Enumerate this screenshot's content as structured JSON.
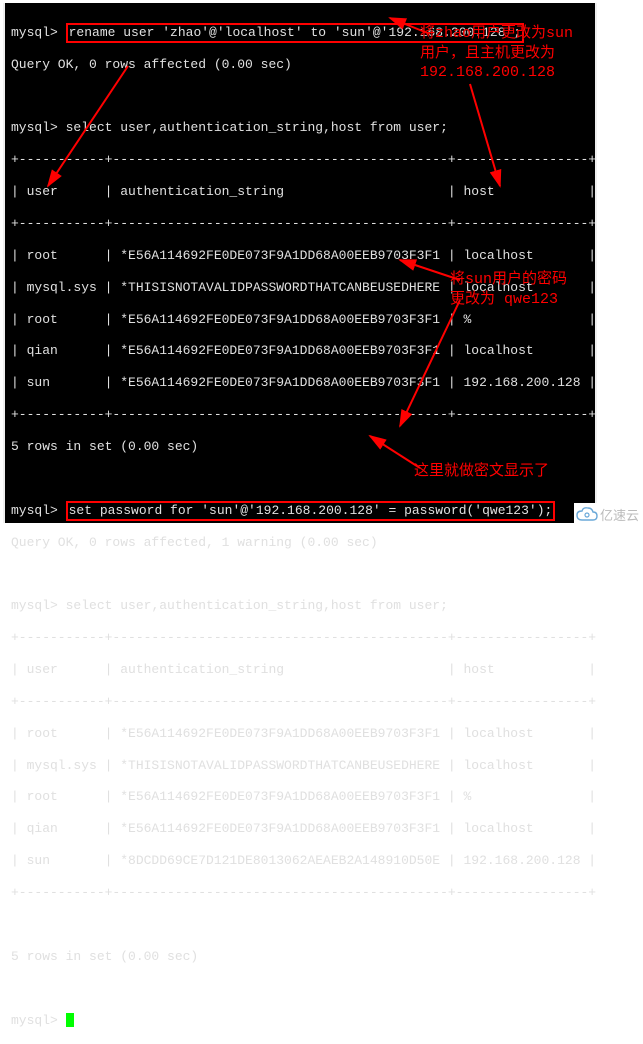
{
  "terminal": {
    "prompt": "mysql>",
    "cmd_rename": "rename user 'zhao'@'localhost' to 'sun'@'192.168.200.128';",
    "ok_rename": "Query OK, 0 rows affected (0.00 sec)",
    "cmd_select1": "select user,authentication_string,host from user;",
    "table_header": "| user      | authentication_string                     | host            |",
    "table_divider": "+-----------+-------------------------------------------+-----------------+",
    "rows1": [
      "| root      | *E56A114692FE0DE073F9A1DD68A00EEB9703F3F1 | localhost       |",
      "| mysql.sys | *THISISNOTAVALIDPASSWORDTHATCANBEUSEDHERE | localhost       |",
      "| root      | *E56A114692FE0DE073F9A1DD68A00EEB9703F3F1 | %               |",
      "| qian      | *E56A114692FE0DE073F9A1DD68A00EEB9703F3F1 | localhost       |",
      "| sun       | *E56A114692FE0DE073F9A1DD68A00EEB9703F3F1 | 192.168.200.128 |"
    ],
    "rows_in_set": "5 rows in set (0.00 sec)",
    "cmd_setpw": "set password for 'sun'@'192.168.200.128' = password('qwe123');",
    "ok_setpw": "Query OK, 0 rows affected, 1 warning (0.00 sec)",
    "cmd_select2": "select user,authentication_string,host from user;",
    "rows2": [
      "| root      | *E56A114692FE0DE073F9A1DD68A00EEB9703F3F1 | localhost       |",
      "| mysql.sys | *THISISNOTAVALIDPASSWORDTHATCANBEUSEDHERE | localhost       |",
      "| root      | *E56A114692FE0DE073F9A1DD68A00EEB9703F3F1 | %               |",
      "| qian      | *E56A114692FE0DE073F9A1DD68A00EEB9703F3F1 | localhost       |",
      "| sun       | *8DCDD69CE7D121DE8013062AEAEB2A148910D50E | 192.168.200.128 |"
    ]
  },
  "annotations": {
    "note1": "将zhao用户更改为sun\n用户，且主机更改为\n192.168.200.128",
    "note2": "将sun用户的密码\n更改为 qwe123",
    "note3": "这里就做密文显示了"
  },
  "watermark": {
    "text": "亿速云"
  }
}
